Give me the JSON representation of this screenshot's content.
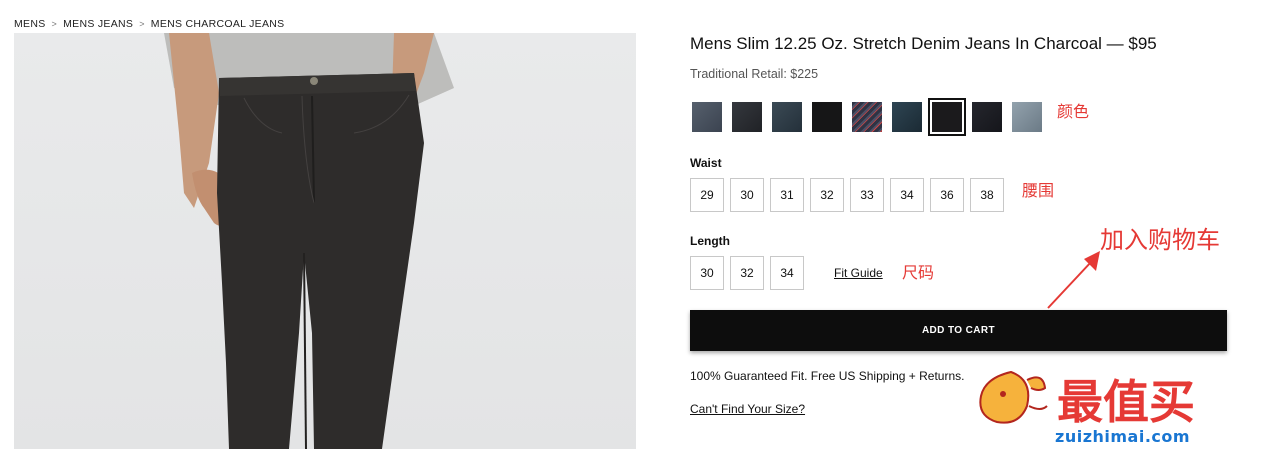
{
  "breadcrumb": {
    "items": [
      "MENS",
      "MENS JEANS",
      "MENS CHARCOAL JEANS"
    ],
    "separator": ">"
  },
  "product": {
    "title": "Mens Slim 12.25 Oz. Stretch Denim Jeans In Charcoal — $95",
    "retail": "Traditional Retail: $225",
    "swatches": [
      {
        "color": "#4a4f5a",
        "icon": "denim-swatch"
      },
      {
        "color": "#2b2e33",
        "icon": "denim-swatch"
      },
      {
        "color": "#2f3c45",
        "icon": "denim-swatch"
      },
      {
        "color": "#1a1a1b",
        "icon": "denim-swatch"
      },
      {
        "color": "#3b3f52",
        "icon": "denim-swatch"
      },
      {
        "color": "#253845",
        "icon": "denim-swatch"
      },
      {
        "color": "#1c1b1d",
        "icon": "denim-swatch",
        "selected": true
      },
      {
        "color": "#1e1f25",
        "icon": "denim-swatch"
      },
      {
        "color": "#7f8e9a",
        "icon": "denim-swatch"
      }
    ],
    "waist_label": "Waist",
    "waist": [
      "29",
      "30",
      "31",
      "32",
      "33",
      "34",
      "36",
      "38"
    ],
    "length_label": "Length",
    "length": [
      "30",
      "32",
      "34"
    ],
    "fit_guide": "Fit Guide",
    "add_to_cart": "ADD TO CART",
    "guarantee": "100% Guaranteed Fit. Free US Shipping + Returns.",
    "cant_find": "Can't Find Your Size?"
  },
  "annotations": {
    "color": "颜色",
    "waist": "腰围",
    "size": "尺码",
    "add_to_cart": "加入购物车",
    "accent": "#e53935"
  },
  "watermark": {
    "logo_text": "最值买",
    "url": "zuizhimai.com",
    "logo_color": "#e53935",
    "url_color": "#1976d2"
  }
}
